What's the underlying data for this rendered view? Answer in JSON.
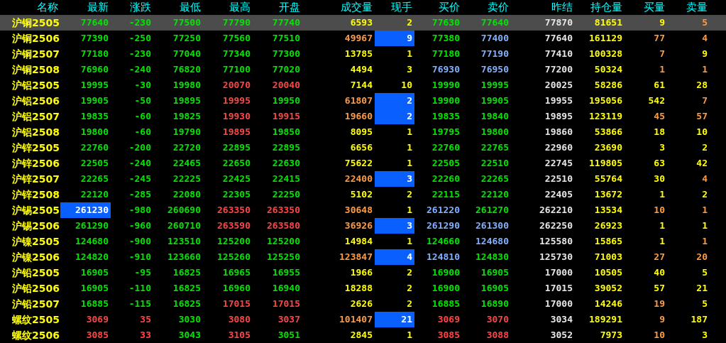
{
  "table": {
    "columns": [
      "名称",
      "最新",
      "涨跌",
      "最低",
      "最高",
      "开盘",
      "成交量",
      "现手",
      "买价",
      "卖价",
      "昨结",
      "持仓量",
      "买量",
      "卖量"
    ],
    "rows": [
      {
        "selected": true,
        "cells": [
          {
            "text": "沪铜2505",
            "color": "#ffff00",
            "highlighted": false
          },
          {
            "text": "77640",
            "color": "#00e600",
            "highlighted": false
          },
          {
            "text": "-230",
            "color": "#00e600",
            "highlighted": false
          },
          {
            "text": "77500",
            "color": "#00e600",
            "highlighted": false
          },
          {
            "text": "77790",
            "color": "#00e600",
            "highlighted": false
          },
          {
            "text": "77740",
            "color": "#00e600",
            "highlighted": false
          },
          {
            "text": "6593",
            "color": "#ffff00",
            "highlighted": false
          },
          {
            "text": "2",
            "color": "#ffff00",
            "highlighted": false
          },
          {
            "text": "77630",
            "color": "#00e600",
            "highlighted": false
          },
          {
            "text": "77640",
            "color": "#00e600",
            "highlighted": false
          },
          {
            "text": "77870",
            "color": "#e6e6e6",
            "highlighted": false
          },
          {
            "text": "81651",
            "color": "#ffff00",
            "highlighted": false
          },
          {
            "text": "9",
            "color": "#ffff00",
            "highlighted": false
          },
          {
            "text": "5",
            "color": "#ff9a40",
            "highlighted": false
          }
        ]
      },
      {
        "selected": false,
        "cells": [
          {
            "text": "沪铜2506",
            "color": "#ffff00",
            "highlighted": false
          },
          {
            "text": "77390",
            "color": "#00e600",
            "highlighted": false
          },
          {
            "text": "-250",
            "color": "#00e600",
            "highlighted": false
          },
          {
            "text": "77250",
            "color": "#00e600",
            "highlighted": false
          },
          {
            "text": "77560",
            "color": "#00e600",
            "highlighted": false
          },
          {
            "text": "77510",
            "color": "#00e600",
            "highlighted": false
          },
          {
            "text": "49967",
            "color": "#ff9a40",
            "highlighted": false
          },
          {
            "text": "9",
            "highlighted": true
          },
          {
            "text": "77380",
            "color": "#00e600",
            "highlighted": false
          },
          {
            "text": "77400",
            "color": "#80b0ff",
            "highlighted": false
          },
          {
            "text": "77640",
            "color": "#e6e6e6",
            "highlighted": false
          },
          {
            "text": "161129",
            "color": "#ffff00",
            "highlighted": false
          },
          {
            "text": "77",
            "color": "#ff9a40",
            "highlighted": false
          },
          {
            "text": "4",
            "color": "#ff9a40",
            "highlighted": false
          }
        ]
      },
      {
        "selected": false,
        "cells": [
          {
            "text": "沪铜2507",
            "color": "#ffff00",
            "highlighted": false
          },
          {
            "text": "77180",
            "color": "#00e600",
            "highlighted": false
          },
          {
            "text": "-230",
            "color": "#00e600",
            "highlighted": false
          },
          {
            "text": "77040",
            "color": "#00e600",
            "highlighted": false
          },
          {
            "text": "77340",
            "color": "#00e600",
            "highlighted": false
          },
          {
            "text": "77300",
            "color": "#00e600",
            "highlighted": false
          },
          {
            "text": "13785",
            "color": "#ffff00",
            "highlighted": false
          },
          {
            "text": "1",
            "color": "#ffff00",
            "highlighted": false
          },
          {
            "text": "77180",
            "color": "#00e600",
            "highlighted": false
          },
          {
            "text": "77190",
            "color": "#80b0ff",
            "highlighted": false
          },
          {
            "text": "77410",
            "color": "#e6e6e6",
            "highlighted": false
          },
          {
            "text": "100328",
            "color": "#ffff00",
            "highlighted": false
          },
          {
            "text": "7",
            "color": "#ff9a40",
            "highlighted": false
          },
          {
            "text": "9",
            "color": "#ffff00",
            "highlighted": false
          }
        ]
      },
      {
        "selected": false,
        "cells": [
          {
            "text": "沪铜2508",
            "color": "#ffff00",
            "highlighted": false
          },
          {
            "text": "76960",
            "color": "#00e600",
            "highlighted": false
          },
          {
            "text": "-240",
            "color": "#00e600",
            "highlighted": false
          },
          {
            "text": "76820",
            "color": "#00e600",
            "highlighted": false
          },
          {
            "text": "77100",
            "color": "#00e600",
            "highlighted": false
          },
          {
            "text": "77020",
            "color": "#00e600",
            "highlighted": false
          },
          {
            "text": "4494",
            "color": "#ffff00",
            "highlighted": false
          },
          {
            "text": "3",
            "color": "#ffff00",
            "highlighted": false
          },
          {
            "text": "76930",
            "color": "#80b0ff",
            "highlighted": false
          },
          {
            "text": "76950",
            "color": "#80b0ff",
            "highlighted": false
          },
          {
            "text": "77200",
            "color": "#e6e6e6",
            "highlighted": false
          },
          {
            "text": "50324",
            "color": "#ffff00",
            "highlighted": false
          },
          {
            "text": "1",
            "color": "#ff9a40",
            "highlighted": false
          },
          {
            "text": "1",
            "color": "#ff9a40",
            "highlighted": false
          }
        ]
      },
      {
        "selected": false,
        "cells": [
          {
            "text": "沪铝2505",
            "color": "#ffff00",
            "highlighted": false
          },
          {
            "text": "19995",
            "color": "#00e600",
            "highlighted": false
          },
          {
            "text": "-30",
            "color": "#00e600",
            "highlighted": false
          },
          {
            "text": "19980",
            "color": "#00e600",
            "highlighted": false
          },
          {
            "text": "20070",
            "color": "#ff4444",
            "highlighted": false
          },
          {
            "text": "20040",
            "color": "#ff4444",
            "highlighted": false
          },
          {
            "text": "7144",
            "color": "#ffff00",
            "highlighted": false
          },
          {
            "text": "10",
            "color": "#ffff00",
            "highlighted": false
          },
          {
            "text": "19990",
            "color": "#00e600",
            "highlighted": false
          },
          {
            "text": "19995",
            "color": "#00e600",
            "highlighted": false
          },
          {
            "text": "20025",
            "color": "#e6e6e6",
            "highlighted": false
          },
          {
            "text": "58286",
            "color": "#ffff00",
            "highlighted": false
          },
          {
            "text": "61",
            "color": "#ffff00",
            "highlighted": false
          },
          {
            "text": "28",
            "color": "#ffff00",
            "highlighted": false
          }
        ]
      },
      {
        "selected": false,
        "cells": [
          {
            "text": "沪铝2506",
            "color": "#ffff00",
            "highlighted": false
          },
          {
            "text": "19905",
            "color": "#00e600",
            "highlighted": false
          },
          {
            "text": "-50",
            "color": "#00e600",
            "highlighted": false
          },
          {
            "text": "19895",
            "color": "#00e600",
            "highlighted": false
          },
          {
            "text": "19995",
            "color": "#ff4444",
            "highlighted": false
          },
          {
            "text": "19950",
            "color": "#00e600",
            "highlighted": false
          },
          {
            "text": "61807",
            "color": "#ff9a40",
            "highlighted": false
          },
          {
            "text": "2",
            "highlighted": true
          },
          {
            "text": "19900",
            "color": "#00e600",
            "highlighted": false
          },
          {
            "text": "19905",
            "color": "#00e600",
            "highlighted": false
          },
          {
            "text": "19955",
            "color": "#e6e6e6",
            "highlighted": false
          },
          {
            "text": "195056",
            "color": "#ffff00",
            "highlighted": false
          },
          {
            "text": "542",
            "color": "#ffff00",
            "highlighted": false
          },
          {
            "text": "7",
            "color": "#ff9a40",
            "highlighted": false
          }
        ]
      },
      {
        "selected": false,
        "cells": [
          {
            "text": "沪铝2507",
            "color": "#ffff00",
            "highlighted": false
          },
          {
            "text": "19835",
            "color": "#00e600",
            "highlighted": false
          },
          {
            "text": "-60",
            "color": "#00e600",
            "highlighted": false
          },
          {
            "text": "19825",
            "color": "#00e600",
            "highlighted": false
          },
          {
            "text": "19930",
            "color": "#ff4444",
            "highlighted": false
          },
          {
            "text": "19915",
            "color": "#ff4444",
            "highlighted": false
          },
          {
            "text": "19660",
            "color": "#ff9a40",
            "highlighted": false
          },
          {
            "text": "2",
            "highlighted": true
          },
          {
            "text": "19835",
            "color": "#00e600",
            "highlighted": false
          },
          {
            "text": "19840",
            "color": "#00e600",
            "highlighted": false
          },
          {
            "text": "19895",
            "color": "#e6e6e6",
            "highlighted": false
          },
          {
            "text": "123119",
            "color": "#ffff00",
            "highlighted": false
          },
          {
            "text": "45",
            "color": "#ff9a40",
            "highlighted": false
          },
          {
            "text": "57",
            "color": "#ff9a40",
            "highlighted": false
          }
        ]
      },
      {
        "selected": false,
        "cells": [
          {
            "text": "沪铝2508",
            "color": "#ffff00",
            "highlighted": false
          },
          {
            "text": "19800",
            "color": "#00e600",
            "highlighted": false
          },
          {
            "text": "-60",
            "color": "#00e600",
            "highlighted": false
          },
          {
            "text": "19790",
            "color": "#00e600",
            "highlighted": false
          },
          {
            "text": "19895",
            "color": "#ff4444",
            "highlighted": false
          },
          {
            "text": "19850",
            "color": "#00e600",
            "highlighted": false
          },
          {
            "text": "8095",
            "color": "#ffff00",
            "highlighted": false
          },
          {
            "text": "1",
            "color": "#ffff00",
            "highlighted": false
          },
          {
            "text": "19795",
            "color": "#00e600",
            "highlighted": false
          },
          {
            "text": "19800",
            "color": "#00e600",
            "highlighted": false
          },
          {
            "text": "19860",
            "color": "#e6e6e6",
            "highlighted": false
          },
          {
            "text": "53866",
            "color": "#ffff00",
            "highlighted": false
          },
          {
            "text": "18",
            "color": "#ffff00",
            "highlighted": false
          },
          {
            "text": "10",
            "color": "#ffff00",
            "highlighted": false
          }
        ]
      },
      {
        "selected": false,
        "cells": [
          {
            "text": "沪锌2505",
            "color": "#ffff00",
            "highlighted": false
          },
          {
            "text": "22760",
            "color": "#00e600",
            "highlighted": false
          },
          {
            "text": "-200",
            "color": "#00e600",
            "highlighted": false
          },
          {
            "text": "22720",
            "color": "#00e600",
            "highlighted": false
          },
          {
            "text": "22895",
            "color": "#00e600",
            "highlighted": false
          },
          {
            "text": "22895",
            "color": "#00e600",
            "highlighted": false
          },
          {
            "text": "6656",
            "color": "#ffff00",
            "highlighted": false
          },
          {
            "text": "1",
            "color": "#ffff00",
            "highlighted": false
          },
          {
            "text": "22760",
            "color": "#00e600",
            "highlighted": false
          },
          {
            "text": "22765",
            "color": "#00e600",
            "highlighted": false
          },
          {
            "text": "22960",
            "color": "#e6e6e6",
            "highlighted": false
          },
          {
            "text": "23690",
            "color": "#ffff00",
            "highlighted": false
          },
          {
            "text": "3",
            "color": "#ffff00",
            "highlighted": false
          },
          {
            "text": "2",
            "color": "#ffff00",
            "highlighted": false
          }
        ]
      },
      {
        "selected": false,
        "cells": [
          {
            "text": "沪锌2506",
            "color": "#ffff00",
            "highlighted": false
          },
          {
            "text": "22505",
            "color": "#00e600",
            "highlighted": false
          },
          {
            "text": "-240",
            "color": "#00e600",
            "highlighted": false
          },
          {
            "text": "22465",
            "color": "#00e600",
            "highlighted": false
          },
          {
            "text": "22650",
            "color": "#00e600",
            "highlighted": false
          },
          {
            "text": "22630",
            "color": "#00e600",
            "highlighted": false
          },
          {
            "text": "75622",
            "color": "#ffff00",
            "highlighted": false
          },
          {
            "text": "1",
            "color": "#ffff00",
            "highlighted": false
          },
          {
            "text": "22505",
            "color": "#00e600",
            "highlighted": false
          },
          {
            "text": "22510",
            "color": "#00e600",
            "highlighted": false
          },
          {
            "text": "22745",
            "color": "#e6e6e6",
            "highlighted": false
          },
          {
            "text": "119805",
            "color": "#ffff00",
            "highlighted": false
          },
          {
            "text": "63",
            "color": "#ffff00",
            "highlighted": false
          },
          {
            "text": "42",
            "color": "#ffff00",
            "highlighted": false
          }
        ]
      },
      {
        "selected": false,
        "cells": [
          {
            "text": "沪锌2507",
            "color": "#ffff00",
            "highlighted": false
          },
          {
            "text": "22265",
            "color": "#00e600",
            "highlighted": false
          },
          {
            "text": "-245",
            "color": "#00e600",
            "highlighted": false
          },
          {
            "text": "22225",
            "color": "#00e600",
            "highlighted": false
          },
          {
            "text": "22425",
            "color": "#00e600",
            "highlighted": false
          },
          {
            "text": "22415",
            "color": "#00e600",
            "highlighted": false
          },
          {
            "text": "22400",
            "color": "#ff9a40",
            "highlighted": false
          },
          {
            "text": "3",
            "highlighted": true
          },
          {
            "text": "22260",
            "color": "#00e600",
            "highlighted": false
          },
          {
            "text": "22265",
            "color": "#00e600",
            "highlighted": false
          },
          {
            "text": "22510",
            "color": "#e6e6e6",
            "highlighted": false
          },
          {
            "text": "55764",
            "color": "#ffff00",
            "highlighted": false
          },
          {
            "text": "30",
            "color": "#ffff00",
            "highlighted": false
          },
          {
            "text": "4",
            "color": "#ff9a40",
            "highlighted": false
          }
        ]
      },
      {
        "selected": false,
        "cells": [
          {
            "text": "沪锌2508",
            "color": "#ffff00",
            "highlighted": false
          },
          {
            "text": "22120",
            "color": "#00e600",
            "highlighted": false
          },
          {
            "text": "-285",
            "color": "#00e600",
            "highlighted": false
          },
          {
            "text": "22080",
            "color": "#00e600",
            "highlighted": false
          },
          {
            "text": "22305",
            "color": "#00e600",
            "highlighted": false
          },
          {
            "text": "22250",
            "color": "#00e600",
            "highlighted": false
          },
          {
            "text": "5102",
            "color": "#ffff00",
            "highlighted": false
          },
          {
            "text": "2",
            "color": "#ffff00",
            "highlighted": false
          },
          {
            "text": "22115",
            "color": "#00e600",
            "highlighted": false
          },
          {
            "text": "22120",
            "color": "#00e600",
            "highlighted": false
          },
          {
            "text": "22405",
            "color": "#e6e6e6",
            "highlighted": false
          },
          {
            "text": "13672",
            "color": "#ffff00",
            "highlighted": false
          },
          {
            "text": "1",
            "color": "#ffff00",
            "highlighted": false
          },
          {
            "text": "2",
            "color": "#ffff00",
            "highlighted": false
          }
        ]
      },
      {
        "selected": false,
        "cells": [
          {
            "text": "沪锡2505",
            "color": "#ffff00",
            "highlighted": false
          },
          {
            "text": "261230",
            "highlighted": true
          },
          {
            "text": "-980",
            "color": "#00e600",
            "highlighted": false
          },
          {
            "text": "260690",
            "color": "#00e600",
            "highlighted": false
          },
          {
            "text": "263350",
            "color": "#ff4444",
            "highlighted": false
          },
          {
            "text": "263350",
            "color": "#ff4444",
            "highlighted": false
          },
          {
            "text": "30648",
            "color": "#ff9a40",
            "highlighted": false
          },
          {
            "text": "1",
            "color": "#ffff00",
            "highlighted": false
          },
          {
            "text": "261220",
            "color": "#80b0ff",
            "highlighted": false
          },
          {
            "text": "261270",
            "color": "#00e600",
            "highlighted": false
          },
          {
            "text": "262210",
            "color": "#e6e6e6",
            "highlighted": false
          },
          {
            "text": "13534",
            "color": "#ffff00",
            "highlighted": false
          },
          {
            "text": "10",
            "color": "#ff9a40",
            "highlighted": false
          },
          {
            "text": "1",
            "color": "#ff9a40",
            "highlighted": false
          }
        ]
      },
      {
        "selected": false,
        "cells": [
          {
            "text": "沪锡2506",
            "color": "#ffff00",
            "highlighted": false
          },
          {
            "text": "261290",
            "color": "#00e600",
            "highlighted": false
          },
          {
            "text": "-960",
            "color": "#00e600",
            "highlighted": false
          },
          {
            "text": "260710",
            "color": "#00e600",
            "highlighted": false
          },
          {
            "text": "263590",
            "color": "#ff4444",
            "highlighted": false
          },
          {
            "text": "263580",
            "color": "#ff4444",
            "highlighted": false
          },
          {
            "text": "36926",
            "color": "#ff9a40",
            "highlighted": false
          },
          {
            "text": "3",
            "highlighted": true
          },
          {
            "text": "261290",
            "color": "#80b0ff",
            "highlighted": false
          },
          {
            "text": "261300",
            "color": "#80b0ff",
            "highlighted": false
          },
          {
            "text": "262250",
            "color": "#e6e6e6",
            "highlighted": false
          },
          {
            "text": "26923",
            "color": "#ffff00",
            "highlighted": false
          },
          {
            "text": "1",
            "color": "#ffff00",
            "highlighted": false
          },
          {
            "text": "1",
            "color": "#ffff00",
            "highlighted": false
          }
        ]
      },
      {
        "selected": false,
        "cells": [
          {
            "text": "沪镍2505",
            "color": "#ffff00",
            "highlighted": false
          },
          {
            "text": "124680",
            "color": "#00e600",
            "highlighted": false
          },
          {
            "text": "-900",
            "color": "#00e600",
            "highlighted": false
          },
          {
            "text": "123510",
            "color": "#00e600",
            "highlighted": false
          },
          {
            "text": "125200",
            "color": "#00e600",
            "highlighted": false
          },
          {
            "text": "125200",
            "color": "#00e600",
            "highlighted": false
          },
          {
            "text": "14984",
            "color": "#ffff00",
            "highlighted": false
          },
          {
            "text": "1",
            "color": "#ffff00",
            "highlighted": false
          },
          {
            "text": "124660",
            "color": "#00e600",
            "highlighted": false
          },
          {
            "text": "124680",
            "color": "#80b0ff",
            "highlighted": false
          },
          {
            "text": "125580",
            "color": "#e6e6e6",
            "highlighted": false
          },
          {
            "text": "15865",
            "color": "#ffff00",
            "highlighted": false
          },
          {
            "text": "1",
            "color": "#ffff00",
            "highlighted": false
          },
          {
            "text": "1",
            "color": "#ff9a40",
            "highlighted": false
          }
        ]
      },
      {
        "selected": false,
        "cells": [
          {
            "text": "沪镍2506",
            "color": "#ffff00",
            "highlighted": false
          },
          {
            "text": "124820",
            "color": "#00e600",
            "highlighted": false
          },
          {
            "text": "-910",
            "color": "#00e600",
            "highlighted": false
          },
          {
            "text": "123660",
            "color": "#00e600",
            "highlighted": false
          },
          {
            "text": "125260",
            "color": "#00e600",
            "highlighted": false
          },
          {
            "text": "125250",
            "color": "#00e600",
            "highlighted": false
          },
          {
            "text": "123847",
            "color": "#ff9a40",
            "highlighted": false
          },
          {
            "text": "4",
            "highlighted": true
          },
          {
            "text": "124810",
            "color": "#80b0ff",
            "highlighted": false
          },
          {
            "text": "124830",
            "color": "#00e600",
            "highlighted": false
          },
          {
            "text": "125730",
            "color": "#e6e6e6",
            "highlighted": false
          },
          {
            "text": "71003",
            "color": "#ffff00",
            "highlighted": false
          },
          {
            "text": "27",
            "color": "#ff9a40",
            "highlighted": false
          },
          {
            "text": "20",
            "color": "#ff9a40",
            "highlighted": false
          }
        ]
      },
      {
        "selected": false,
        "cells": [
          {
            "text": "沪铅2505",
            "color": "#ffff00",
            "highlighted": false
          },
          {
            "text": "16905",
            "color": "#00e600",
            "highlighted": false
          },
          {
            "text": "-95",
            "color": "#00e600",
            "highlighted": false
          },
          {
            "text": "16825",
            "color": "#00e600",
            "highlighted": false
          },
          {
            "text": "16965",
            "color": "#00e600",
            "highlighted": false
          },
          {
            "text": "16955",
            "color": "#00e600",
            "highlighted": false
          },
          {
            "text": "1966",
            "color": "#ffff00",
            "highlighted": false
          },
          {
            "text": "2",
            "color": "#ffff00",
            "highlighted": false
          },
          {
            "text": "16900",
            "color": "#00e600",
            "highlighted": false
          },
          {
            "text": "16905",
            "color": "#00e600",
            "highlighted": false
          },
          {
            "text": "17000",
            "color": "#e6e6e6",
            "highlighted": false
          },
          {
            "text": "10505",
            "color": "#ffff00",
            "highlighted": false
          },
          {
            "text": "40",
            "color": "#ffff00",
            "highlighted": false
          },
          {
            "text": "5",
            "color": "#ffff00",
            "highlighted": false
          }
        ]
      },
      {
        "selected": false,
        "cells": [
          {
            "text": "沪铅2506",
            "color": "#ffff00",
            "highlighted": false
          },
          {
            "text": "16905",
            "color": "#00e600",
            "highlighted": false
          },
          {
            "text": "-110",
            "color": "#00e600",
            "highlighted": false
          },
          {
            "text": "16825",
            "color": "#00e600",
            "highlighted": false
          },
          {
            "text": "16960",
            "color": "#00e600",
            "highlighted": false
          },
          {
            "text": "16940",
            "color": "#00e600",
            "highlighted": false
          },
          {
            "text": "18288",
            "color": "#ffff00",
            "highlighted": false
          },
          {
            "text": "2",
            "color": "#ffff00",
            "highlighted": false
          },
          {
            "text": "16900",
            "color": "#00e600",
            "highlighted": false
          },
          {
            "text": "16905",
            "color": "#00e600",
            "highlighted": false
          },
          {
            "text": "17015",
            "color": "#e6e6e6",
            "highlighted": false
          },
          {
            "text": "39052",
            "color": "#ffff00",
            "highlighted": false
          },
          {
            "text": "57",
            "color": "#ffff00",
            "highlighted": false
          },
          {
            "text": "21",
            "color": "#ffff00",
            "highlighted": false
          }
        ]
      },
      {
        "selected": false,
        "cells": [
          {
            "text": "沪铅2507",
            "color": "#ffff00",
            "highlighted": false
          },
          {
            "text": "16885",
            "color": "#00e600",
            "highlighted": false
          },
          {
            "text": "-115",
            "color": "#00e600",
            "highlighted": false
          },
          {
            "text": "16825",
            "color": "#00e600",
            "highlighted": false
          },
          {
            "text": "17015",
            "color": "#ff4444",
            "highlighted": false
          },
          {
            "text": "17015",
            "color": "#ff4444",
            "highlighted": false
          },
          {
            "text": "2626",
            "color": "#ffff00",
            "highlighted": false
          },
          {
            "text": "2",
            "color": "#ffff00",
            "highlighted": false
          },
          {
            "text": "16885",
            "color": "#00e600",
            "highlighted": false
          },
          {
            "text": "16890",
            "color": "#00e600",
            "highlighted": false
          },
          {
            "text": "17000",
            "color": "#e6e6e6",
            "highlighted": false
          },
          {
            "text": "14246",
            "color": "#ffff00",
            "highlighted": false
          },
          {
            "text": "19",
            "color": "#ff9a40",
            "highlighted": false
          },
          {
            "text": "5",
            "color": "#ffff00",
            "highlighted": false
          }
        ]
      },
      {
        "selected": false,
        "cells": [
          {
            "text": "螺纹2505",
            "color": "#ffff00",
            "highlighted": false
          },
          {
            "text": "3069",
            "color": "#ff4444",
            "highlighted": false
          },
          {
            "text": "35",
            "color": "#ff4444",
            "highlighted": false
          },
          {
            "text": "3030",
            "color": "#00e600",
            "highlighted": false
          },
          {
            "text": "3080",
            "color": "#ff4444",
            "highlighted": false
          },
          {
            "text": "3037",
            "color": "#ff4444",
            "highlighted": false
          },
          {
            "text": "101407",
            "color": "#ff9a40",
            "highlighted": false
          },
          {
            "text": "21",
            "highlighted": true
          },
          {
            "text": "3069",
            "color": "#ff4444",
            "highlighted": false
          },
          {
            "text": "3070",
            "color": "#ff4444",
            "highlighted": false
          },
          {
            "text": "3034",
            "color": "#e6e6e6",
            "highlighted": false
          },
          {
            "text": "189291",
            "color": "#ffff00",
            "highlighted": false
          },
          {
            "text": "9",
            "color": "#ff9a40",
            "highlighted": false
          },
          {
            "text": "187",
            "color": "#ffff00",
            "highlighted": false
          }
        ]
      },
      {
        "selected": false,
        "cells": [
          {
            "text": "螺纹2506",
            "color": "#ffff00",
            "highlighted": false
          },
          {
            "text": "3085",
            "color": "#ff4444",
            "highlighted": false
          },
          {
            "text": "33",
            "color": "#ff4444",
            "highlighted": false
          },
          {
            "text": "3043",
            "color": "#00e600",
            "highlighted": false
          },
          {
            "text": "3105",
            "color": "#ff4444",
            "highlighted": false
          },
          {
            "text": "3051",
            "color": "#00e600",
            "highlighted": false
          },
          {
            "text": "2845",
            "color": "#ffff00",
            "highlighted": false
          },
          {
            "text": "1",
            "color": "#ffff00",
            "highlighted": false
          },
          {
            "text": "3085",
            "color": "#ff4444",
            "highlighted": false
          },
          {
            "text": "3088",
            "color": "#ff4444",
            "highlighted": false
          },
          {
            "text": "3052",
            "color": "#e6e6e6",
            "highlighted": false
          },
          {
            "text": "7973",
            "color": "#ffff00",
            "highlighted": false
          },
          {
            "text": "10",
            "color": "#ff9a40",
            "highlighted": false
          },
          {
            "text": "3",
            "color": "#ffff00",
            "highlighted": false
          }
        ]
      }
    ]
  }
}
